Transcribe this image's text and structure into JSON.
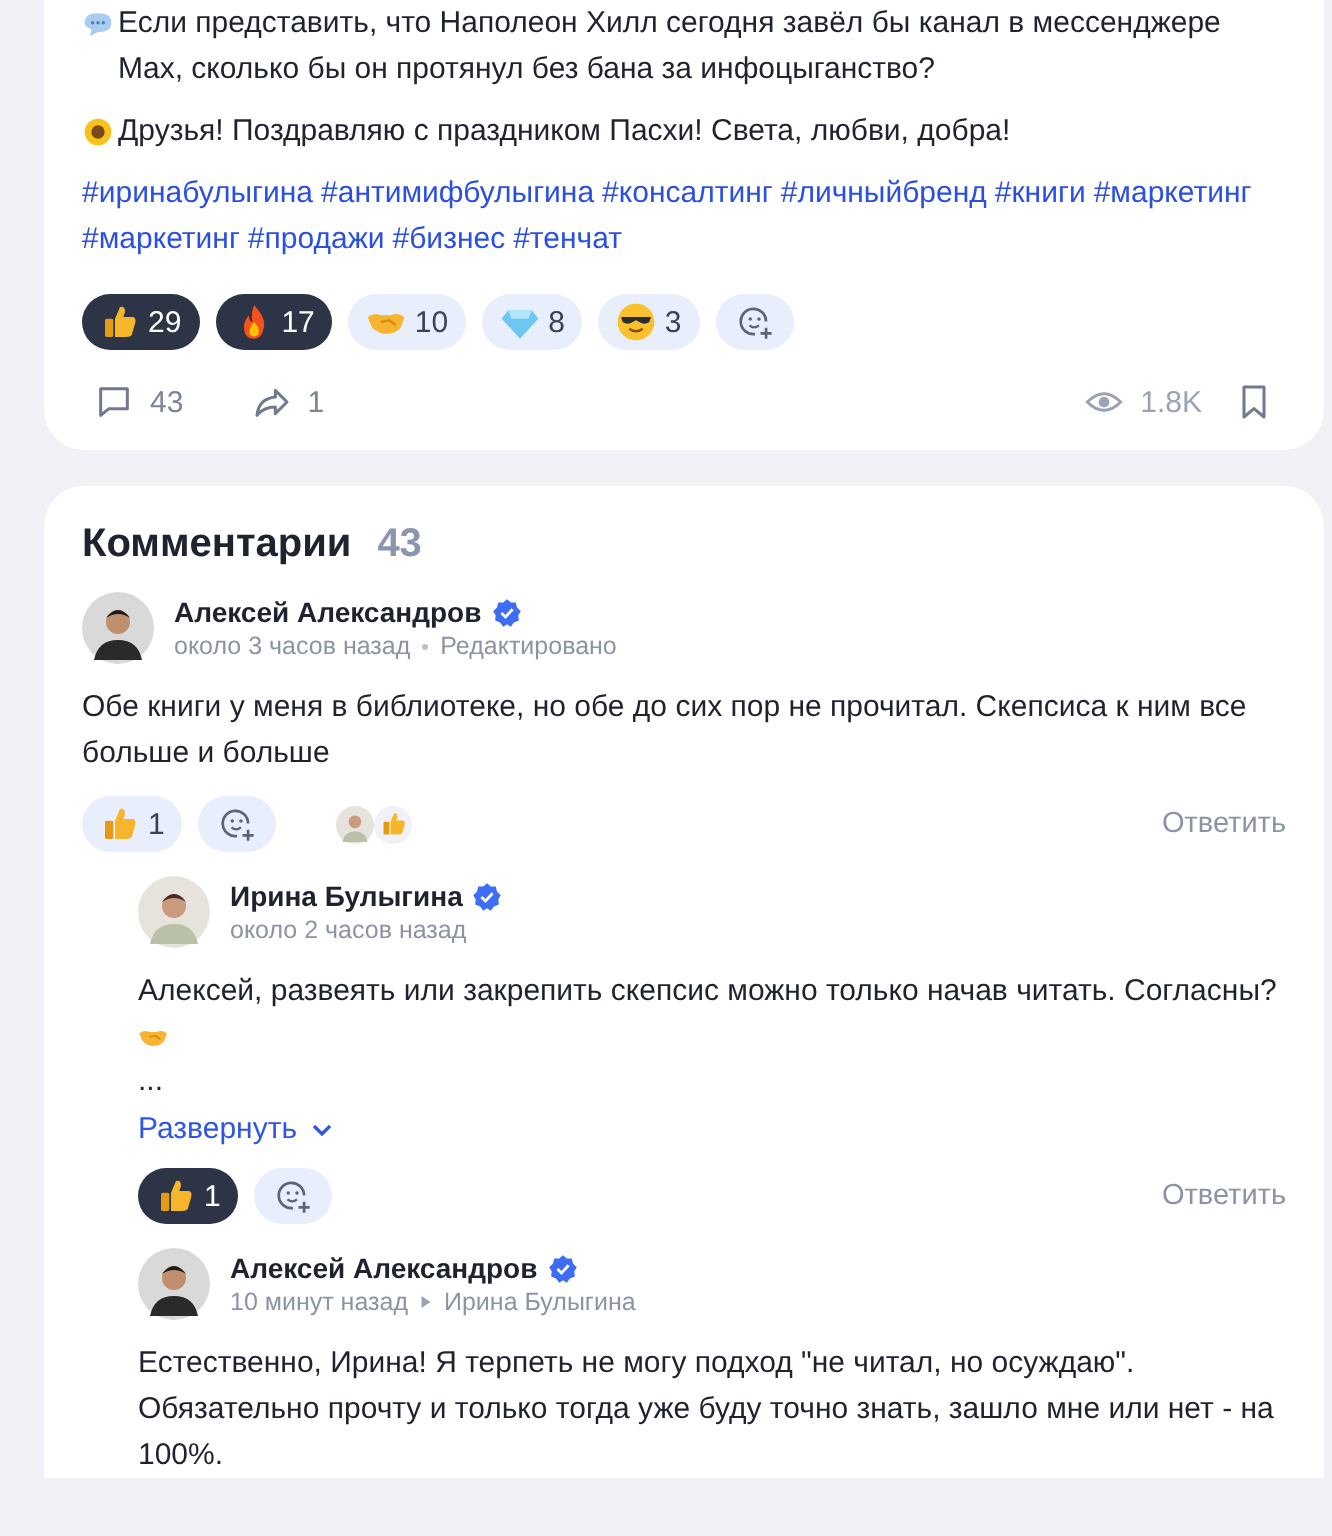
{
  "post": {
    "paragraphs": [
      {
        "kind": "speech_bubble",
        "text": "Если представить, что Наполеон Хилл сегодня завёл бы канал в мессенджере Max, сколько бы он протянул без бана за инфоцыганство?"
      },
      {
        "kind": "sunflower",
        "text": "Друзья! Поздравляю с праздником Пасхи! Света, любви, добра!"
      }
    ],
    "hashtags": [
      "#иринабулыгина",
      "#антимифбулыгина",
      "#консалтинг",
      "#личныйбренд",
      "#книги",
      "#маркетинг",
      "#маркетинг",
      "#продажи",
      "#бизнес",
      "#тенчат"
    ],
    "reactions": [
      {
        "kind": "thumbs_up",
        "count": "29",
        "selected": true
      },
      {
        "kind": "fire",
        "count": "17",
        "selected": true
      },
      {
        "kind": "handshake",
        "count": "10",
        "selected": false
      },
      {
        "kind": "diamond",
        "count": "8",
        "selected": false
      },
      {
        "kind": "sunglasses",
        "count": "3",
        "selected": false
      }
    ],
    "stats": {
      "comments": "43",
      "shares": "1",
      "views": "1.8K",
      "bookmarked": false
    }
  },
  "comments_section": {
    "title": "Комментарии",
    "count": "43",
    "comments": [
      {
        "author": "Алексей Александров",
        "verified": true,
        "time": "около 3 часов назад",
        "edited": "Редактировано",
        "lines": [
          {
            "kind": "text",
            "text": "Обе книги у меня в библиотеке, но обе до сих пор не прочитал. Скепсиса к ним все больше и больше"
          }
        ],
        "reactions": [
          {
            "kind": "thumbs_up",
            "count": "1",
            "selected": false
          }
        ],
        "reacted_by": [
          {
            "kind": "thumbs_up"
          }
        ],
        "reply_label": "Ответить",
        "children": [
          {
            "author": "Ирина Булыгина",
            "verified": true,
            "time": "около 2 часов назад",
            "lines": [
              {
                "kind": "text",
                "text": "Алексей, развеять или закрепить скепсис можно только начав читать. Согласны?"
              },
              {
                "kind": "handshake"
              },
              {
                "kind": "text",
                "text": "..."
              }
            ],
            "expand_label": "Развернуть",
            "reactions": [
              {
                "kind": "thumbs_up",
                "count": "1",
                "selected": true
              }
            ],
            "reply_label": "Ответить"
          },
          {
            "author": "Алексей Александров",
            "verified": true,
            "time": "10 минут назад",
            "reply_to": "Ирина Булыгина",
            "lines": [
              {
                "kind": "text",
                "text": "Естественно, Ирина! Я терпеть не могу подход \"не читал, но осуждаю\". Обязательно прочту и только тогда уже буду точно знать, зашло мне или нет - на 100%."
              }
            ]
          }
        ]
      }
    ]
  }
}
